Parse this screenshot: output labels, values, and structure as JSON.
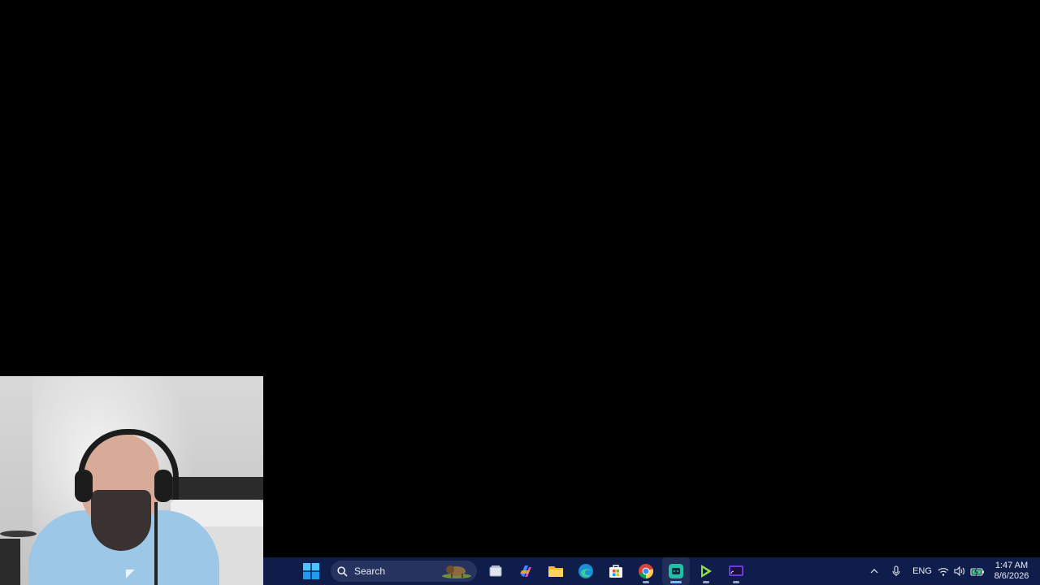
{
  "taskbar": {
    "search_placeholder": "Search",
    "pinned": [
      {
        "name": "Task View",
        "icon": "task-view-icon"
      },
      {
        "name": "Copilot",
        "icon": "copilot-icon"
      },
      {
        "name": "File Explorer",
        "icon": "folder-icon"
      },
      {
        "name": "Microsoft Edge",
        "icon": "edge-icon"
      },
      {
        "name": "Microsoft Store",
        "icon": "store-icon"
      },
      {
        "name": "Google Chrome",
        "icon": "chrome-icon"
      },
      {
        "name": "Messaging App",
        "icon": "chat-app-icon",
        "active": true
      },
      {
        "name": "Media App",
        "icon": "play-app-icon"
      },
      {
        "name": "Cast App",
        "icon": "cast-icon"
      }
    ],
    "tray": {
      "language": "ENG",
      "time": "1:47 AM",
      "date": "8/6/2026"
    }
  },
  "colors": {
    "taskbar_bg": "#0f1d4a",
    "desktop_bg": "#000000",
    "accent": "#7fb6ff"
  }
}
